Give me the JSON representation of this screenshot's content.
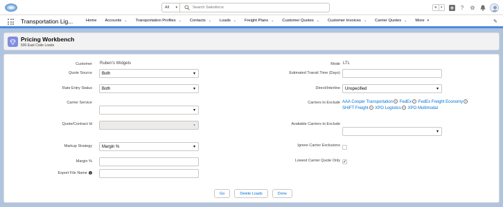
{
  "search": {
    "scope": "All",
    "placeholder": "Search Salesforce"
  },
  "app": {
    "name": "Transportation Lig..."
  },
  "nav": {
    "items": [
      {
        "label": "Home",
        "has_menu": false
      },
      {
        "label": "Accounts",
        "has_menu": true
      },
      {
        "label": "Transportation Profiles",
        "has_menu": true
      },
      {
        "label": "Contacts",
        "has_menu": true
      },
      {
        "label": "Loads",
        "has_menu": true
      },
      {
        "label": "Freight Plans",
        "has_menu": true
      },
      {
        "label": "Customer Quotes",
        "has_menu": true
      },
      {
        "label": "Customer Invoices",
        "has_menu": true
      },
      {
        "label": "Carrier Quotes",
        "has_menu": true
      },
      {
        "label": "More",
        "has_menu": true
      }
    ]
  },
  "page": {
    "title": "Pricing Workbench",
    "subtitle": "500 East Code Loads"
  },
  "form": {
    "customer_label": "Customer",
    "customer_value": "Ruben's Widgets",
    "quote_source_label": "Quote Source",
    "quote_source_value": "Both",
    "rate_entry_label": "Rate Entry Status",
    "rate_entry_value": "Both",
    "carrier_service_label": "Carrier Service",
    "carrier_service_value": "",
    "quote_contract_label": "Quote/Contract Id",
    "markup_label": "Markup Strategy",
    "markup_value": "Margin %",
    "margin_label": "Margin %",
    "export_label": "Export File Name",
    "mode_label": "Mode",
    "mode_value": "LTL",
    "transit_label": "Estimated Transit Time (Days)",
    "direct_label": "Direct/Interline",
    "direct_value": "Unspecified",
    "exclude_label": "Carriers to Exclude",
    "carriers_to_exclude": [
      "AAA Cooper Transportation",
      "FedEx",
      "FedEx Freight Economy",
      "SHIFT Freight",
      "XPO Logistics",
      "XPO Multimodal"
    ],
    "available_label": "Available Carriers to Exclude",
    "ignore_label": "Ignore Carrier Exclusions",
    "ignore_checked": false,
    "lowest_label": "Lowest Carrier Quote Only",
    "lowest_checked": true
  },
  "buttons": {
    "go": "Go",
    "delete": "Delete Loads",
    "done": "Done"
  },
  "colors": {
    "accent": "#4a8ae0",
    "link": "#0070d2",
    "page_bg": "#b0c4df",
    "icon_bg": "#7f8de1"
  }
}
